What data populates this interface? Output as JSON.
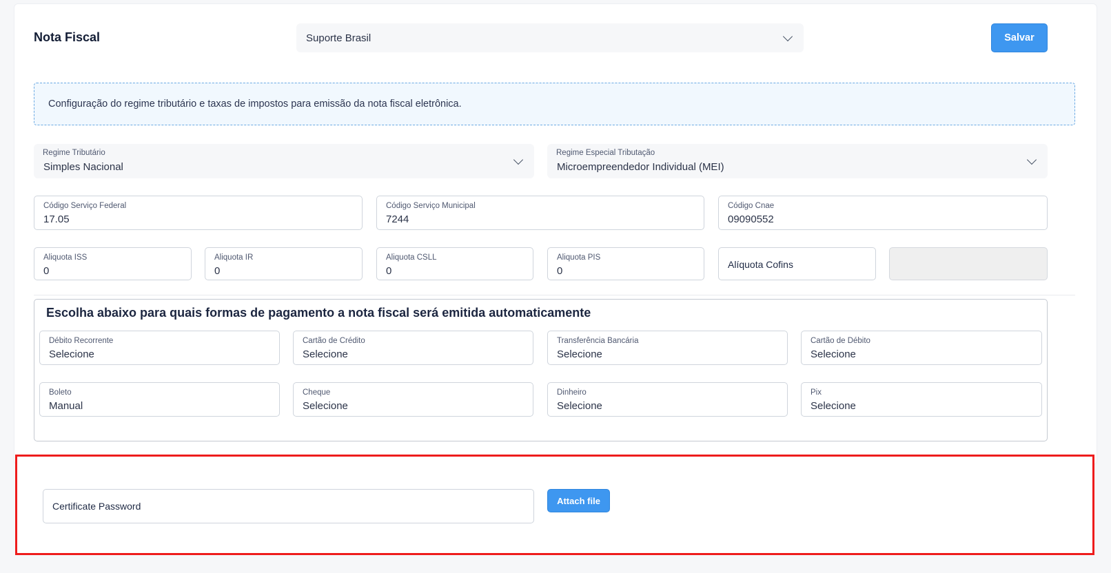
{
  "header": {
    "title": "Nota Fiscal",
    "company_select": "Suporte Brasil",
    "save_label": "Salvar"
  },
  "info_text": "Configuração do regime tributário e taxas de impostos para emissão da nota fiscal eletrônica.",
  "regime": {
    "tributario": {
      "label": "Regime Tributário",
      "value": "Simples Nacional"
    },
    "especial": {
      "label": "Regime Especial Tributação",
      "value": "Microempreendedor Individual (MEI)"
    }
  },
  "codes": {
    "federal": {
      "label": "Código Serviço Federal",
      "value": "17.05"
    },
    "municipal": {
      "label": "Código Serviço Municipal",
      "value": "7244"
    },
    "cnae": {
      "label": "Código Cnae",
      "value": "09090552"
    }
  },
  "aliquotas": {
    "iss": {
      "label": "Aliquota ISS",
      "value": "0"
    },
    "ir": {
      "label": "Aliquota IR",
      "value": "0"
    },
    "csll": {
      "label": "Aliquota CSLL",
      "value": "0"
    },
    "pis": {
      "label": "Aliquota PIS",
      "value": "0"
    },
    "cofins_placeholder": "Alíquota Cofins"
  },
  "payments": {
    "heading": "Escolha abaixo para quais formas de pagamento a nota fiscal será emitida automaticamente",
    "debito_recorrente": {
      "label": "Débito Recorrente",
      "value": "Selecione"
    },
    "cartao_credito": {
      "label": "Cartão de Crédito",
      "value": "Selecione"
    },
    "transferencia": {
      "label": "Transferência Bancária",
      "value": "Selecione"
    },
    "cartao_debito": {
      "label": "Cartão de Débito",
      "value": "Selecione"
    },
    "boleto": {
      "label": "Boleto",
      "value": "Manual"
    },
    "cheque": {
      "label": "Cheque",
      "value": "Selecione"
    },
    "dinheiro": {
      "label": "Dinheiro",
      "value": "Selecione"
    },
    "pix": {
      "label": "Pix",
      "value": "Selecione"
    }
  },
  "certificate": {
    "password_placeholder": "Certificate Password",
    "attach_label": "Attach file"
  },
  "colors": {
    "accent": "#3e97f0",
    "highlight_border": "#ee1c1c"
  }
}
